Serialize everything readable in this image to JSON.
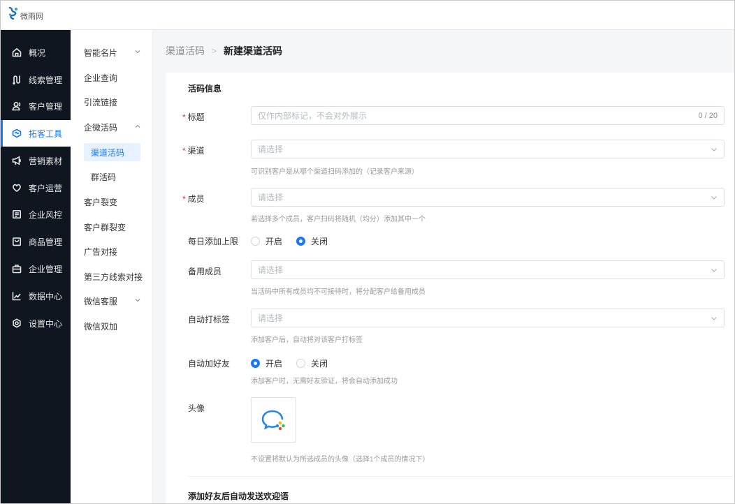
{
  "header": {
    "logo_text": "微雨网"
  },
  "sidebar": {
    "items": [
      {
        "label": "概况",
        "icon": "home-icon"
      },
      {
        "label": "线索管理",
        "icon": "path-icon"
      },
      {
        "label": "客户管理",
        "icon": "users-icon"
      },
      {
        "label": "拓客工具",
        "icon": "handshake-icon",
        "active": true
      },
      {
        "label": "营销素材",
        "icon": "megaphone-icon"
      },
      {
        "label": "客户运营",
        "icon": "heart-hand-icon"
      },
      {
        "label": "企业风控",
        "icon": "document-icon"
      },
      {
        "label": "商品管理",
        "icon": "bag-icon"
      },
      {
        "label": "企业管理",
        "icon": "briefcase-icon"
      },
      {
        "label": "数据中心",
        "icon": "chart-icon"
      },
      {
        "label": "设置中心",
        "icon": "gear-icon"
      }
    ]
  },
  "submenu": {
    "items": [
      {
        "label": "智能名片",
        "expandable": "down"
      },
      {
        "label": "企业查询"
      },
      {
        "label": "引流链接"
      },
      {
        "label": "企微活码",
        "expandable": "up"
      },
      {
        "label": "渠道活码",
        "child": true,
        "selected": true
      },
      {
        "label": "群活码",
        "child": true
      },
      {
        "label": "客户裂变"
      },
      {
        "label": "客户群裂变"
      },
      {
        "label": "广告对接"
      },
      {
        "label": "第三方线索对接"
      },
      {
        "label": "微信客服",
        "expandable": "down"
      },
      {
        "label": "微信双加"
      }
    ]
  },
  "breadcrumb": {
    "parent": "渠道活码",
    "separator": ">",
    "current": "新建渠道活码"
  },
  "form": {
    "section_title": "活码信息",
    "title": {
      "label": "标题",
      "placeholder": "仅作内部标记，不会对外展示",
      "count": "0 / 20",
      "required": true
    },
    "channel": {
      "label": "渠道",
      "placeholder": "请选择",
      "hint": "可识别客户是从哪个渠道扫码添加的（记录客户来源）",
      "required": true
    },
    "member": {
      "label": "成员",
      "placeholder": "请选择",
      "hint": "若选择多个成员，客户扫码将随机（均分）添加其中一个",
      "required": true
    },
    "daily_limit": {
      "label": "每日添加上限",
      "options": [
        "开启",
        "关闭"
      ],
      "selected": "关闭"
    },
    "backup": {
      "label": "备用成员",
      "placeholder": "请选择",
      "hint": "当活码中所有成员均不可接待时，将分配客户给备用成员"
    },
    "auto_tag": {
      "label": "自动打标签",
      "placeholder": "请选择",
      "hint": "添加客户后，自动将对该客户打标签"
    },
    "auto_friend": {
      "label": "自动加好友",
      "options": [
        "开启",
        "关闭"
      ],
      "selected": "开启",
      "hint": "添加客户时，无需好友验证，将会自动添加成功"
    },
    "avatar": {
      "label": "头像",
      "hint": "不设置将默认为所选成员的头像（选择1个成员的情况下）"
    },
    "section2_title": "添加好友后自动发送欢迎语"
  },
  "colors": {
    "accent": "#1677ff",
    "sidebar_bg": "#0f1620",
    "required": "#f5222d"
  }
}
